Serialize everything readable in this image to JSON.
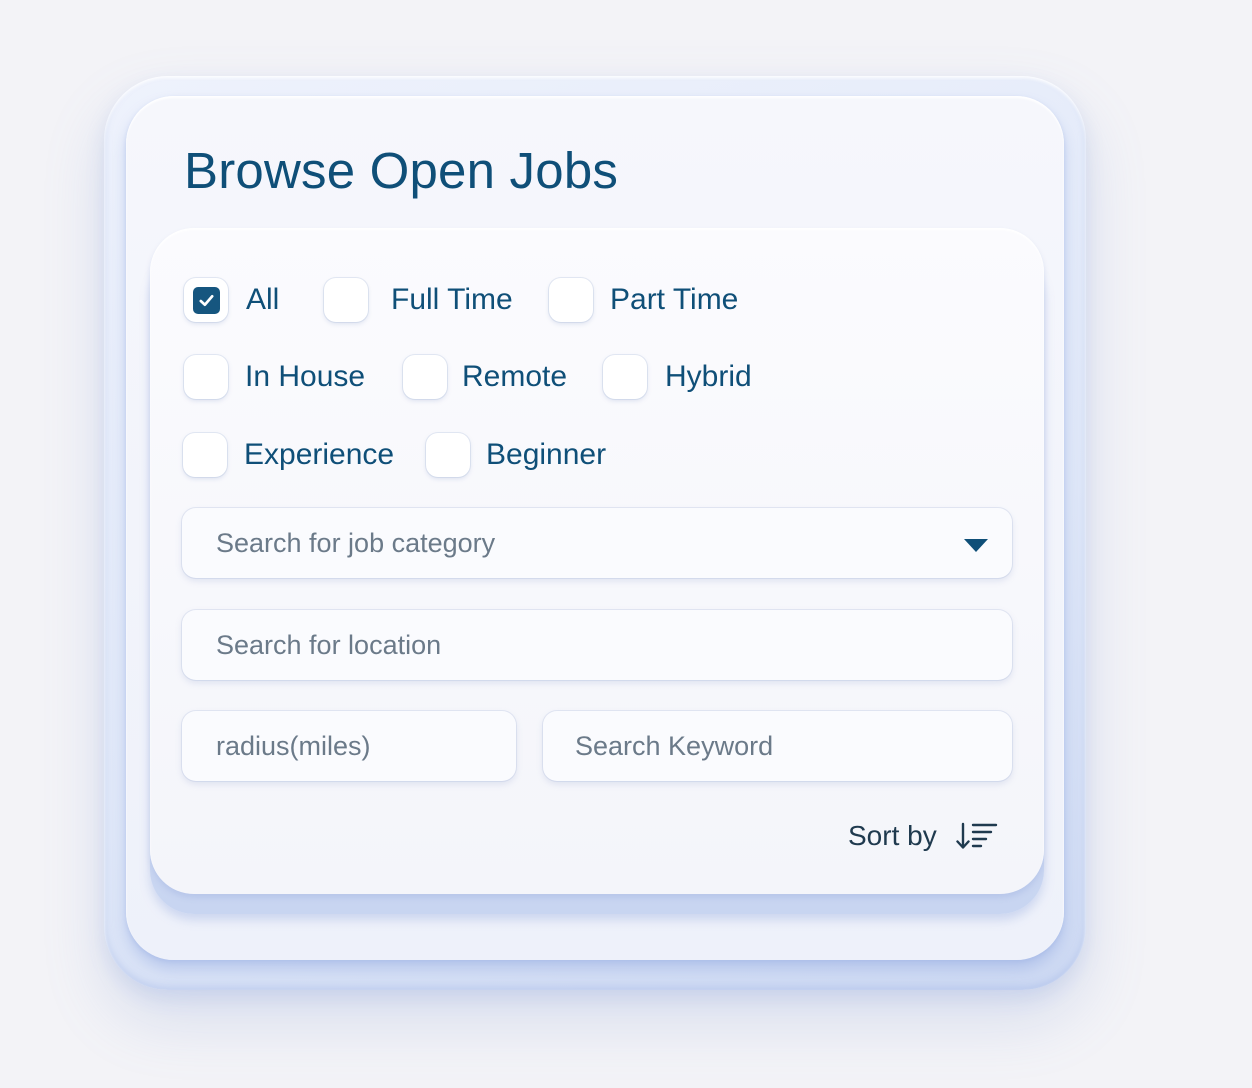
{
  "title": "Browse Open Jobs",
  "filters": [
    {
      "label": "All",
      "checked": true
    },
    {
      "label": "Full Time",
      "checked": false
    },
    {
      "label": "Part Time",
      "checked": false
    },
    {
      "label": "In House",
      "checked": false
    },
    {
      "label": "Remote",
      "checked": false
    },
    {
      "label": "Hybrid",
      "checked": false
    },
    {
      "label": "Experience",
      "checked": false
    },
    {
      "label": "Beginner",
      "checked": false
    }
  ],
  "category_field": {
    "placeholder": "Search for job category",
    "value": "",
    "icon": "triangle-down-icon"
  },
  "location_field": {
    "placeholder": "Search for location",
    "value": ""
  },
  "radius_field": {
    "placeholder": "radius(miles)",
    "value": ""
  },
  "keyword_field": {
    "placeholder": "Search Keyword",
    "value": ""
  },
  "sort": {
    "label": "Sort by",
    "icon": "sort-descending-icon"
  },
  "colors": {
    "primary": "#0f4f78",
    "checkbox_checked": "#16567f",
    "placeholder_text": "#6b7a89",
    "background": "#f3f3f7"
  }
}
